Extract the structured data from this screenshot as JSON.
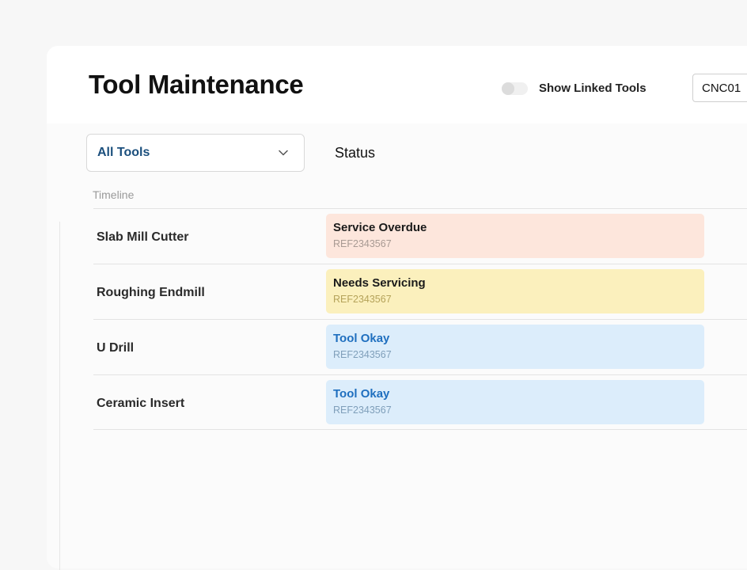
{
  "header": {
    "title": "Tool Maintenance",
    "toggle_label": "Show Linked Tools",
    "toggle_on": false,
    "machine_value": "CNC01"
  },
  "filter": {
    "selected": "All Tools",
    "icon": "chevron-down-icon"
  },
  "columns": {
    "status": "Status",
    "timeline": "Timeline"
  },
  "tools": [
    {
      "name": "Slab Mill Cutter",
      "status": "Service Overdue",
      "ref": "REF2343567",
      "state": "overdue"
    },
    {
      "name": "Roughing Endmill",
      "status": "Needs Servicing",
      "ref": "REF2343567",
      "state": "needs"
    },
    {
      "name": "U Drill",
      "status": "Tool Okay",
      "ref": "REF2343567",
      "state": "okay"
    },
    {
      "name": "Ceramic Insert",
      "status": "Tool Okay",
      "ref": "REF2343567",
      "state": "okay"
    }
  ],
  "colors": {
    "overdue_bg": "#fde6dc",
    "needs_bg": "#fbf0bd",
    "okay_bg": "#dcedfb",
    "accent": "#1f6fbf"
  }
}
